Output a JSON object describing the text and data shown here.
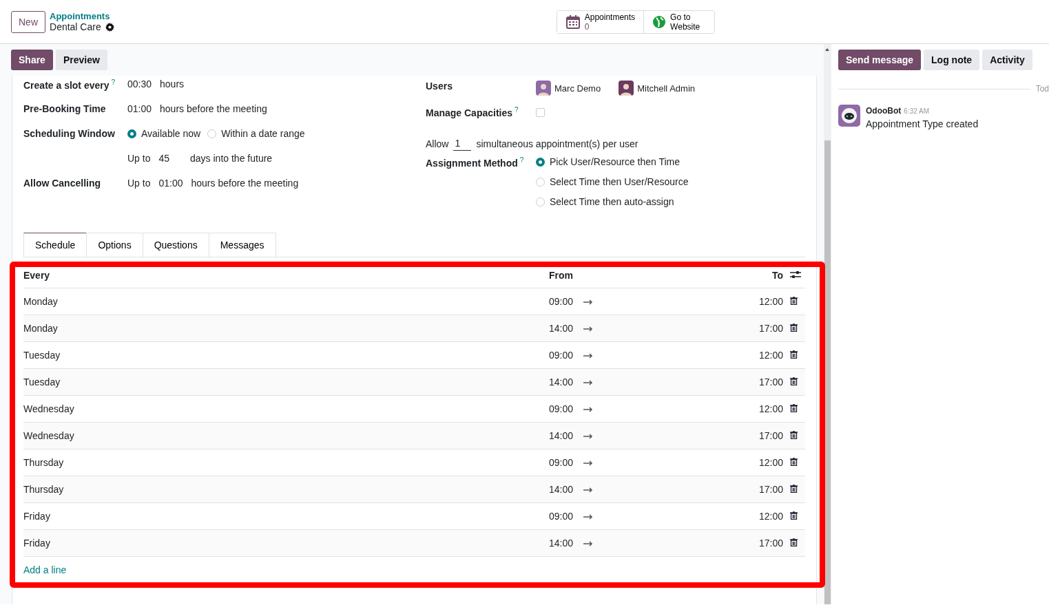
{
  "top_bar": {
    "new_button": "New",
    "breadcrumb": {
      "parent": "Appointments",
      "current": "Dental Care"
    },
    "smart_buttons": [
      {
        "kind": "calendar",
        "label": "Appointments",
        "value": "0"
      },
      {
        "kind": "globe",
        "label": "Go to Website"
      }
    ]
  },
  "actions": [
    {
      "label": "Share",
      "kind": "primary"
    },
    {
      "label": "Preview",
      "kind": "secondary"
    }
  ],
  "form_left": [
    {
      "kind": "duration",
      "label": "Create a slot every",
      "help": "?",
      "value": "00:30",
      "suffix": "hours"
    },
    {
      "kind": "duration",
      "label": "Pre-Booking Time",
      "value": "01:00",
      "suffix": "hours before the meeting"
    },
    {
      "kind": "radio",
      "label": "Scheduling Window",
      "options": [
        {
          "label": "Available now",
          "selected": true
        },
        {
          "label": "Within a date range",
          "selected": false
        }
      ]
    },
    {
      "kind": "duration",
      "prefix": "Up to",
      "value": "45",
      "suffix": "days into the future"
    },
    {
      "kind": "duration",
      "label": "Allow Cancelling",
      "prefix": "Up to",
      "value": "01:00",
      "suffix": "hours before the meeting"
    }
  ],
  "form_right": {
    "users": {
      "label": "Users",
      "items": [
        "Marc Demo",
        "Mitchell Admin"
      ]
    },
    "manage_capacities": {
      "label": "Manage Capacities",
      "help": "?",
      "checked": false
    },
    "allow": {
      "prefix": "Allow",
      "value": "1",
      "suffix": "simultaneous appointment(s) per user"
    },
    "assignment": {
      "label": "Assignment Method",
      "help": "?",
      "options": [
        {
          "label": "Pick User/Resource then Time",
          "selected": true
        },
        {
          "label": "Select Time then User/Resource",
          "selected": false
        },
        {
          "label": "Select Time then auto-assign",
          "selected": false
        }
      ]
    }
  },
  "tabs": [
    {
      "label": "Schedule",
      "selected": true
    },
    {
      "label": "Options",
      "selected": false
    },
    {
      "label": "Questions",
      "selected": false
    },
    {
      "label": "Messages",
      "selected": false
    }
  ],
  "table": {
    "columns": [
      "Every",
      "From",
      "To"
    ],
    "rows": [
      {
        "every": "Monday",
        "from": "09:00",
        "to": "12:00"
      },
      {
        "every": "Monday",
        "from": "14:00",
        "to": "17:00"
      },
      {
        "every": "Tuesday",
        "from": "09:00",
        "to": "12:00"
      },
      {
        "every": "Tuesday",
        "from": "14:00",
        "to": "17:00"
      },
      {
        "every": "Wednesday",
        "from": "09:00",
        "to": "12:00"
      },
      {
        "every": "Wednesday",
        "from": "14:00",
        "to": "17:00"
      },
      {
        "every": "Thursday",
        "from": "09:00",
        "to": "12:00"
      },
      {
        "every": "Thursday",
        "from": "14:00",
        "to": "17:00"
      },
      {
        "every": "Friday",
        "from": "09:00",
        "to": "12:00"
      },
      {
        "every": "Friday",
        "from": "14:00",
        "to": "17:00"
      }
    ],
    "add_line": "Add a line"
  },
  "chatter": {
    "buttons": [
      {
        "label": "Send message",
        "kind": "primary"
      },
      {
        "label": "Log note",
        "kind": "secondary"
      },
      {
        "label": "Activity",
        "kind": "secondary"
      }
    ],
    "separator": "Tod",
    "messages": [
      {
        "author": "OdooBot",
        "time": "6:32 AM",
        "body": "Appointment Type created"
      }
    ]
  }
}
